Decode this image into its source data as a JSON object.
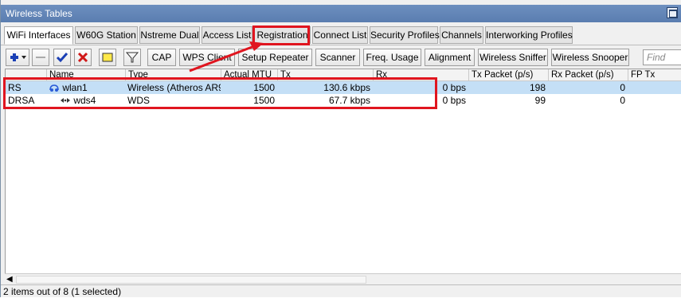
{
  "window": {
    "title": "Wireless Tables"
  },
  "tabs": [
    {
      "label": "WiFi Interfaces",
      "active": true
    },
    {
      "label": "W60G Station"
    },
    {
      "label": "Nstreme Dual"
    },
    {
      "label": "Access List"
    },
    {
      "label": "Registration",
      "highlighted": true
    },
    {
      "label": "Connect List"
    },
    {
      "label": "Security Profiles"
    },
    {
      "label": "Channels"
    },
    {
      "label": "Interworking Profiles"
    }
  ],
  "toolbar": {
    "add_icon": "plus-icon",
    "remove_icon": "minus-icon",
    "enable_icon": "check-icon",
    "disable_icon": "x-icon",
    "comment_icon": "note-icon",
    "filter_icon": "filter-icon",
    "buttons": [
      "CAP",
      "WPS Client",
      "Setup Repeater",
      "Scanner",
      "Freq. Usage",
      "Alignment",
      "Wireless Sniffer",
      "Wireless Snooper"
    ],
    "find_placeholder": "Find"
  },
  "table": {
    "columns": [
      "",
      "Name",
      "Type",
      "Actual MTU",
      "Tx",
      "Rx",
      "Tx Packet (p/s)",
      "Rx Packet (p/s)",
      "FP Tx"
    ],
    "rows": [
      {
        "flag": "RS",
        "name": "wlan1",
        "icon": "wireless-icon",
        "type": "Wireless (Atheros AR9...",
        "mtu": "1500",
        "tx": "130.6 kbps",
        "rx": "0 bps",
        "txp": "198",
        "rxp": "0",
        "fptx": "",
        "selected": true
      },
      {
        "flag": "DRSA",
        "name": "wds4",
        "icon": "wds-icon",
        "type": "WDS",
        "mtu": "1500",
        "tx": "67.7 kbps",
        "rx": "0 bps",
        "txp": "99",
        "rxp": "0",
        "fptx": "",
        "selected": false
      }
    ]
  },
  "status": {
    "text": "2 items out of 8 (1 selected)"
  },
  "colors": {
    "annotation": "#e0151f",
    "selection": "#c4dff6",
    "titlebar": "#5a7db0"
  }
}
